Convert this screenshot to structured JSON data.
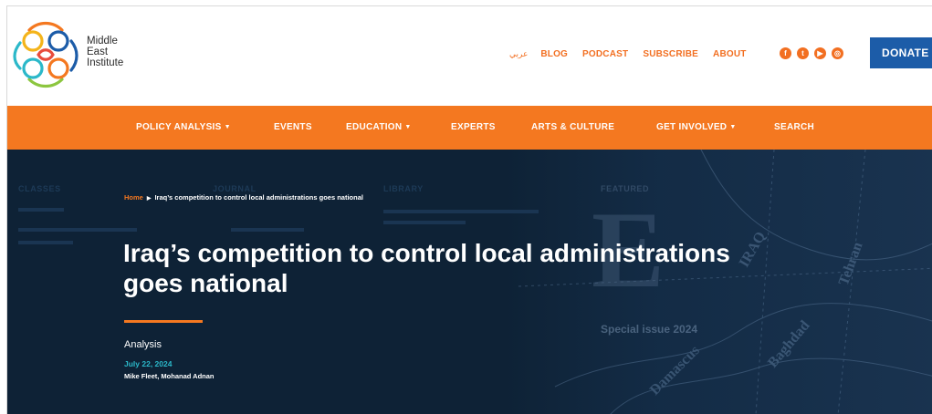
{
  "brand": {
    "line1": "Middle",
    "line2": "East",
    "line3": "Institute",
    "colors": {
      "orange": "#f47820",
      "blue": "#1c5ca8",
      "teal": "#2bb8c9",
      "navy": "#0e2236"
    }
  },
  "toplinks": {
    "arabic": "عربي",
    "items": [
      "BLOG",
      "PODCAST",
      "SUBSCRIBE",
      "ABOUT"
    ]
  },
  "socials": [
    {
      "icon": "facebook-icon",
      "glyph": "f"
    },
    {
      "icon": "twitter-icon",
      "glyph": "t"
    },
    {
      "icon": "youtube-icon",
      "glyph": "▶"
    },
    {
      "icon": "instagram-icon",
      "glyph": "◎"
    }
  ],
  "donate": "DONATE",
  "nav": {
    "items": [
      {
        "label": "POLICY ANALYSIS",
        "caret": "▼"
      },
      {
        "label": "EVENTS",
        "caret": ""
      },
      {
        "label": "EDUCATION",
        "caret": "▼"
      },
      {
        "label": "EXPERTS",
        "caret": ""
      },
      {
        "label": "ARTS & CULTURE",
        "caret": ""
      },
      {
        "label": "GET INVOLVED",
        "caret": "▼"
      },
      {
        "label": "SEARCH",
        "caret": ""
      }
    ]
  },
  "hero": {
    "breadcrumb_home": "Home",
    "breadcrumb_current": "Iraq’s competition to control local administrations goes national",
    "title_line1": "Iraq’s competition to control local administrations",
    "title_line2": "goes national",
    "type": "Analysis",
    "date": "July 22, 2024",
    "authors": "Mike Fleet, Mohanad Adnan",
    "ghost_classes": "CLASSES",
    "ghost_journal": "JOURNAL",
    "ghost_library": "LIBRARY",
    "ghost_featured": "FEATURED",
    "ghost_special": "Special issue 2024"
  }
}
